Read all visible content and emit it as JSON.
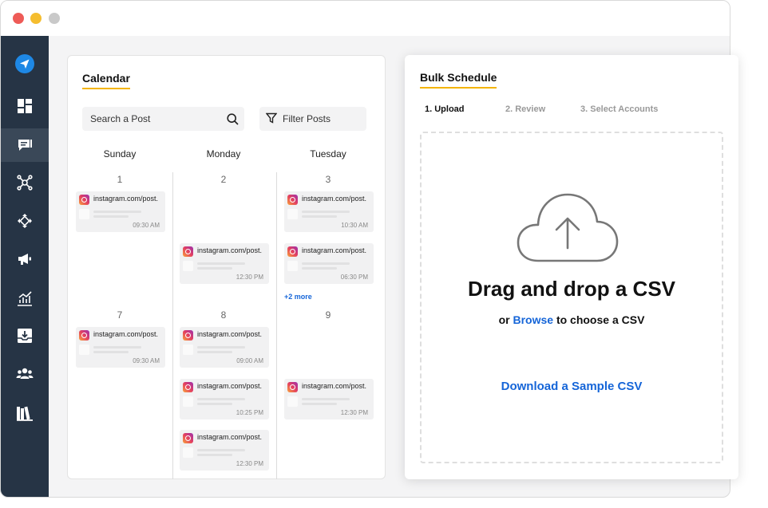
{
  "window": {
    "colors": {
      "close": "#ee5b57",
      "minimize": "#f5bd2f",
      "zoom": "#c9c9c9"
    }
  },
  "sidebar": {
    "items": [
      {
        "icon": "paper-plane-icon"
      },
      {
        "icon": "dashboard-icon"
      },
      {
        "icon": "compose-icon",
        "active": true
      },
      {
        "icon": "network-icon"
      },
      {
        "icon": "move-icon"
      },
      {
        "icon": "megaphone-icon"
      },
      {
        "icon": "analytics-icon"
      },
      {
        "icon": "inbox-icon"
      },
      {
        "icon": "users-icon"
      },
      {
        "icon": "library-icon"
      }
    ]
  },
  "calendar": {
    "title": "Calendar",
    "search": {
      "placeholder": "Search a Post",
      "icon": "search-icon"
    },
    "filter": {
      "label": "Filter Posts",
      "icon": "filter-icon"
    },
    "days": [
      "Sunday",
      "Monday",
      "Tuesday"
    ],
    "weeks": [
      {
        "dates": [
          "1",
          "2",
          "3"
        ],
        "posts": [
          [
            {
              "url": "instagram.com/post.",
              "time": "09:30 AM"
            }
          ],
          [
            {
              "url": "instagram.com/post.",
              "time": "12:30 PM"
            }
          ],
          [
            {
              "url": "instagram.com/post.",
              "time": "10:30 AM"
            },
            {
              "url": "instagram.com/post.",
              "time": "06:30 PM"
            }
          ]
        ],
        "more": "+2 more"
      },
      {
        "dates": [
          "7",
          "8",
          "9"
        ],
        "posts": [
          [
            {
              "url": "instagram.com/post.",
              "time": "09:30 AM"
            }
          ],
          [
            {
              "url": "instagram.com/post.",
              "time": "09:00 AM"
            },
            {
              "url": "instagram.com/post.",
              "time": "10:25 PM"
            },
            {
              "url": "instagram.com/post.",
              "time": "12:30 PM"
            }
          ],
          [
            {
              "url": "instagram.com/post.",
              "time": "12:30 PM"
            }
          ]
        ]
      }
    ]
  },
  "bulk": {
    "title": "Bulk Schedule",
    "steps": [
      {
        "label": "1. Upload",
        "active": true
      },
      {
        "label": "2. Review",
        "active": false
      },
      {
        "label": "3. Select Accounts",
        "active": false
      }
    ],
    "dropzone": {
      "icon": "cloud-upload-icon",
      "title": "Drag and drop a CSV",
      "sub_prefix": "or",
      "browse_label": "Browse",
      "sub_suffix": "to choose a CSV",
      "sample_link": "Download a Sample CSV"
    }
  },
  "colors": {
    "accent": "#f4b400",
    "link": "#1565d8",
    "sidebar": "#263445",
    "sidebar_active": "#3a4858"
  }
}
